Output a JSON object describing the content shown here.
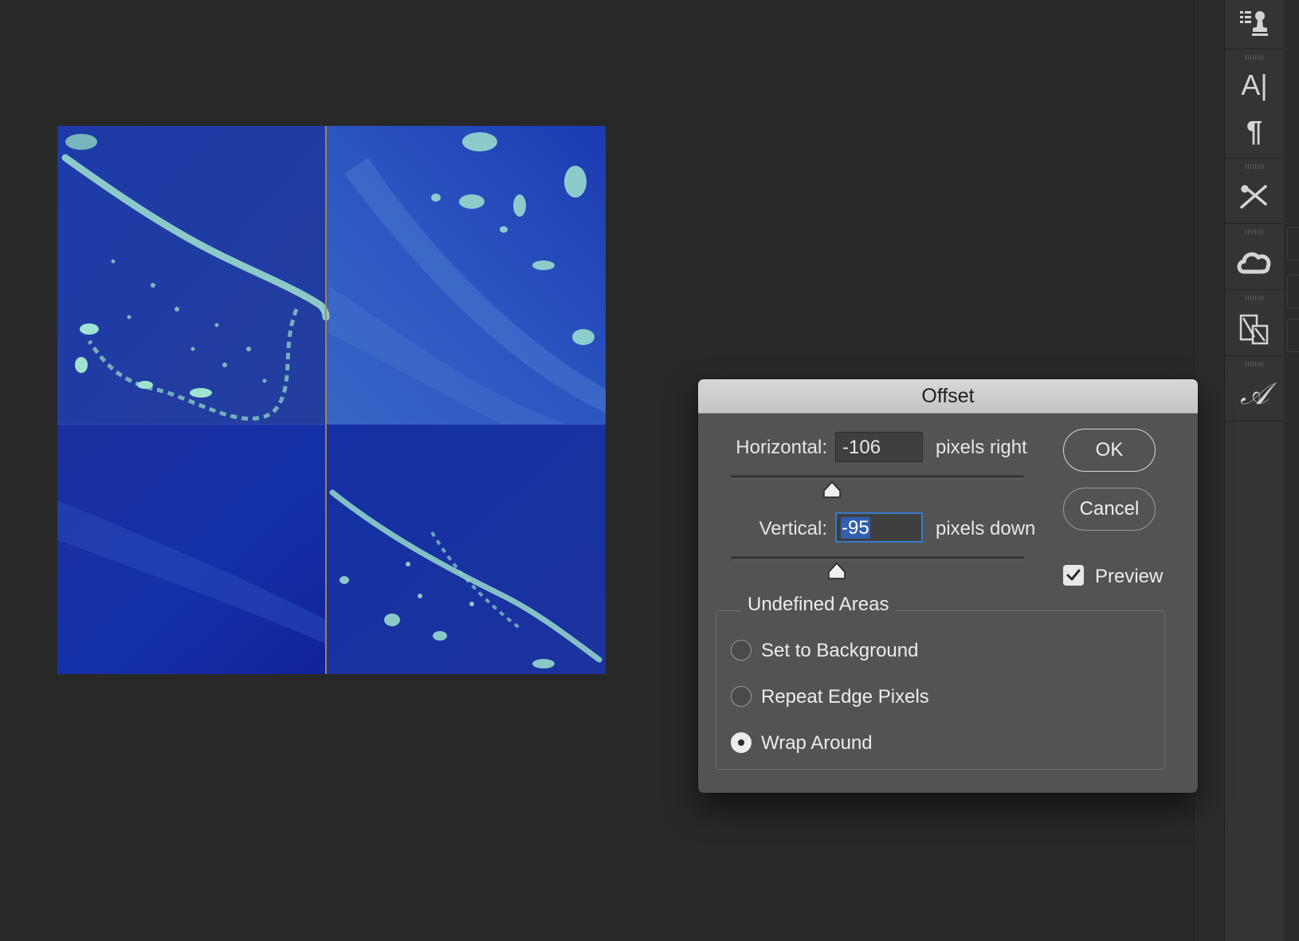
{
  "dialog": {
    "title": "Offset",
    "horizontal": {
      "label": "Horizontal:",
      "value": "-106",
      "unit": "pixels right"
    },
    "vertical": {
      "label": "Vertical:",
      "value": "-95",
      "unit": "pixels down"
    },
    "ok_label": "OK",
    "cancel_label": "Cancel",
    "preview": {
      "label": "Preview",
      "checked": true
    },
    "undefined_areas": {
      "title": "Undefined Areas",
      "options": [
        {
          "label": "Set to Background",
          "selected": false
        },
        {
          "label": "Repeat Edge Pixels",
          "selected": false
        },
        {
          "label": "Wrap Around",
          "selected": true
        }
      ]
    }
  },
  "dock": {
    "icons": [
      "clone-source-icon",
      "character-icon",
      "paragraph-icon",
      "tool-presets-icon",
      "creative-cloud-libraries-icon",
      "device-preview-icon",
      "glyphs-icon"
    ],
    "text_glyphs": {
      "character": "A|",
      "paragraph": "¶",
      "glyphs": "𝒜"
    }
  },
  "colors": {
    "workspace": "#282828",
    "dialog_bg": "#535353",
    "focus_ring": "#3d78c9",
    "selection": "#2f5fae"
  }
}
